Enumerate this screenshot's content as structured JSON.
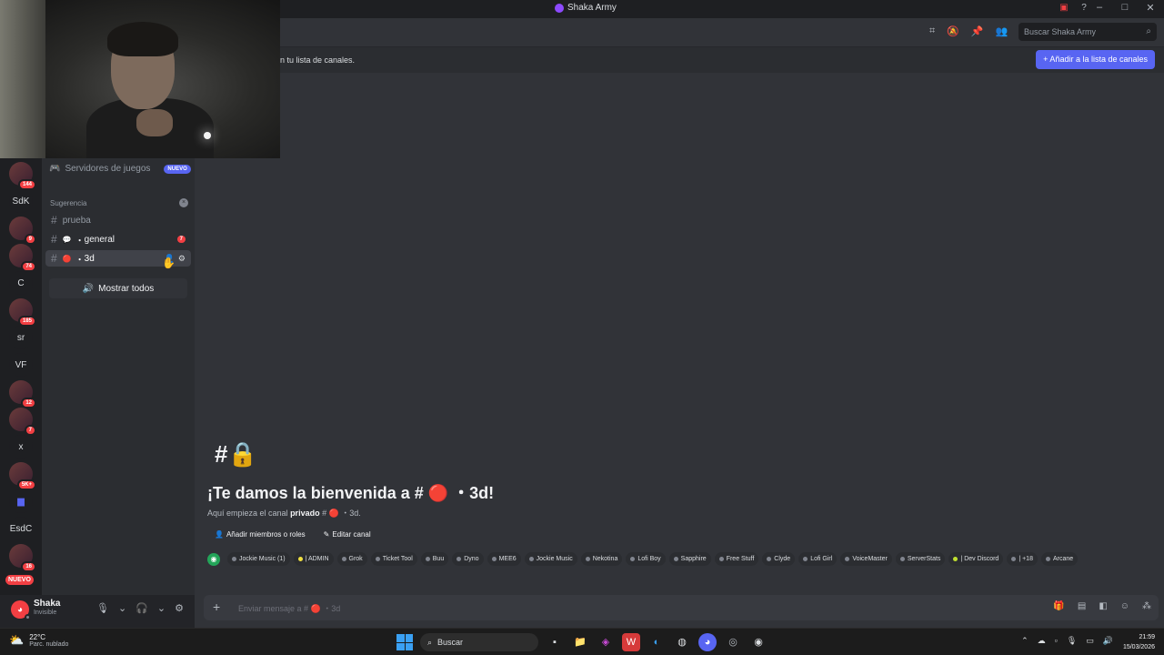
{
  "window": {
    "title": "Shaka Army",
    "controls": [
      "minimize-icon",
      "maximize-icon",
      "close-icon"
    ]
  },
  "rail": {
    "servers": [
      {
        "kind": "image",
        "name": "server-1",
        "badge": "144"
      },
      {
        "kind": "text",
        "label": "SdK"
      },
      {
        "kind": "image",
        "name": "server-3",
        "badge": "9"
      },
      {
        "kind": "image",
        "name": "server-4",
        "badge": "74"
      },
      {
        "kind": "text",
        "label": "C"
      },
      {
        "kind": "image",
        "name": "server-6",
        "badge": "185"
      },
      {
        "kind": "text",
        "label": "sr"
      },
      {
        "kind": "text",
        "label": "VF"
      },
      {
        "kind": "image",
        "name": "server-9",
        "badge": "12"
      },
      {
        "kind": "image",
        "name": "server-10",
        "badge": "7"
      },
      {
        "kind": "text",
        "label": "x"
      },
      {
        "kind": "image",
        "name": "server-12",
        "badge": "5K+"
      },
      {
        "kind": "folder",
        "name": "folder"
      },
      {
        "kind": "text",
        "label": "EsdC"
      },
      {
        "kind": "image",
        "name": "server-15",
        "badge": "16"
      }
    ],
    "nuevo_label": "NUEVO"
  },
  "sidebar": {
    "game_servers_label": "Servidores de juegos",
    "new_badge": "NUEVO",
    "category_label": "Sugerencia",
    "channels": [
      {
        "name": "prueba",
        "emoji": "",
        "badge": "",
        "state": "normal"
      },
      {
        "name": "general",
        "emoji": "💬",
        "badge": "7",
        "state": "unread"
      },
      {
        "name": "3d",
        "emoji": "🔴",
        "badge": "",
        "state": "active"
      }
    ],
    "show_all_label": "Mostrar todos"
  },
  "user": {
    "name": "Shaka",
    "status": "Invisible"
  },
  "header": {
    "search_placeholder": "Buscar Shaka Army"
  },
  "notice": {
    "text": "n tu lista de canales.",
    "button_label": "+ Añadir a la lista de canales"
  },
  "welcome": {
    "title": "¡Te damos la bienvenida a # 🔴 ・3d!",
    "sub_prefix": "Aquí empieza el canal ",
    "sub_bold": "privado",
    "sub_suffix": " # 🔴 ・3d.",
    "add_members_label": "Añadir miembros o roles",
    "edit_channel_label": "Editar canal"
  },
  "bots": [
    {
      "label": "Jockie Music (1)",
      "color": "#80848e"
    },
    {
      "label": "| ADMIN",
      "color": "#f0e040"
    },
    {
      "label": "Grok",
      "color": "#80848e"
    },
    {
      "label": "Ticket Tool",
      "color": "#80848e"
    },
    {
      "label": "Buu",
      "color": "#80848e"
    },
    {
      "label": "Dyno",
      "color": "#80848e"
    },
    {
      "label": "MEE6",
      "color": "#80848e"
    },
    {
      "label": "Jockie Music",
      "color": "#80848e"
    },
    {
      "label": "Nekotina",
      "color": "#80848e"
    },
    {
      "label": "Lofi Boy",
      "color": "#80848e"
    },
    {
      "label": "Sapphire",
      "color": "#80848e"
    },
    {
      "label": "Free Stuff",
      "color": "#80848e"
    },
    {
      "label": "Clyde",
      "color": "#80848e"
    },
    {
      "label": "Lofi Girl",
      "color": "#80848e"
    },
    {
      "label": "VoiceMaster",
      "color": "#80848e"
    },
    {
      "label": "ServerStats",
      "color": "#80848e"
    },
    {
      "label": "| Dev Discord",
      "color": "#c0e030"
    },
    {
      "label": "| +18",
      "color": "#80848e"
    },
    {
      "label": "Arcane",
      "color": "#80848e"
    }
  ],
  "composer": {
    "placeholder": "Enviar mensaje a # 🔴 ・3d"
  },
  "taskbar": {
    "temp": "22°C",
    "weather": "Parc. nublado",
    "search_label": "Buscar",
    "time": "21:59",
    "date": "15/03/2026"
  },
  "colors": {
    "accent": "#5865f2",
    "danger": "#f23f43",
    "online": "#23a559"
  }
}
